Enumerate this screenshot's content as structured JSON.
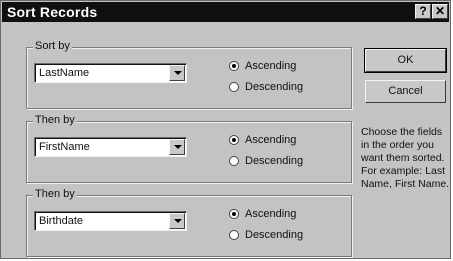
{
  "window": {
    "title": "Sort Records",
    "help_button": "?",
    "close_button": "✕"
  },
  "groups": [
    {
      "label": "Sort by",
      "field": "LastName",
      "options": [
        "Ascending",
        "Descending"
      ],
      "selected": 0
    },
    {
      "label": "Then by",
      "field": "FirstName",
      "options": [
        "Ascending",
        "Descending"
      ],
      "selected": 0
    },
    {
      "label": "Then by",
      "field": "Birthdate",
      "options": [
        "Ascending",
        "Descending"
      ],
      "selected": 0
    }
  ],
  "buttons": {
    "ok": "OK",
    "cancel": "Cancel"
  },
  "help_text": "Choose the fields in the order you want them sorted. For example: Last Name, First Name."
}
